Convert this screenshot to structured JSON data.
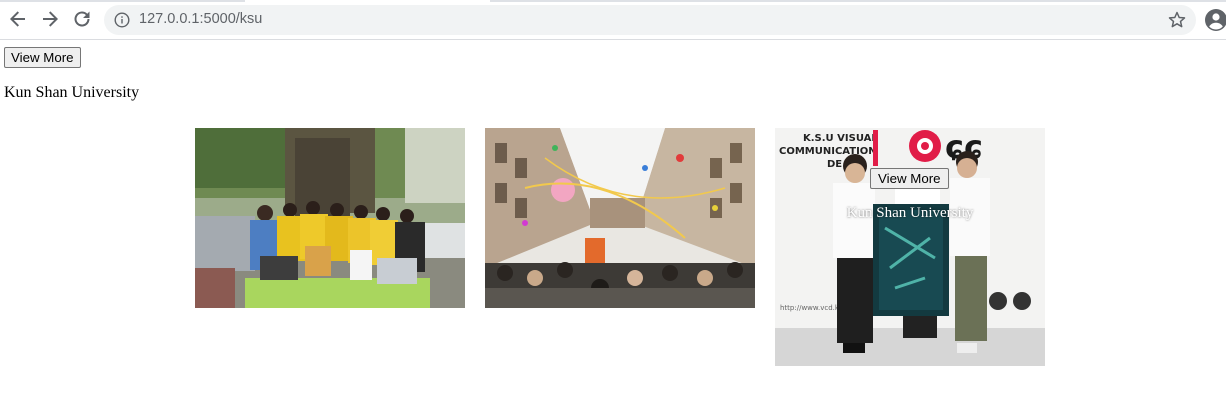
{
  "browser": {
    "url": "127.0.0.1:5000/ksu",
    "back_icon": "arrow-left-icon",
    "forward_icon": "arrow-right-icon",
    "reload_icon": "reload-icon",
    "info_icon": "info-icon",
    "bookmark_icon": "star-icon",
    "profile_icon": "account-circle-icon"
  },
  "page": {
    "view_more_label": "View More",
    "heading": "Kun Shan University"
  },
  "gallery": {
    "images": [
      {
        "name": "students-under-tree"
      },
      {
        "name": "celebration-courtyard"
      },
      {
        "name": "visual-communication-poster",
        "sign_text": "K.S.U VISUAL COMMUNICATION DE",
        "url_text": "http://www.vcd.ksu"
      }
    ],
    "overlay": {
      "view_more_label": "View More",
      "caption": "Kun Shan University"
    }
  },
  "colors": {
    "chrome_bg": "#ffffff",
    "omnibox_bg": "#f1f3f4",
    "icon": "#5f6368"
  }
}
